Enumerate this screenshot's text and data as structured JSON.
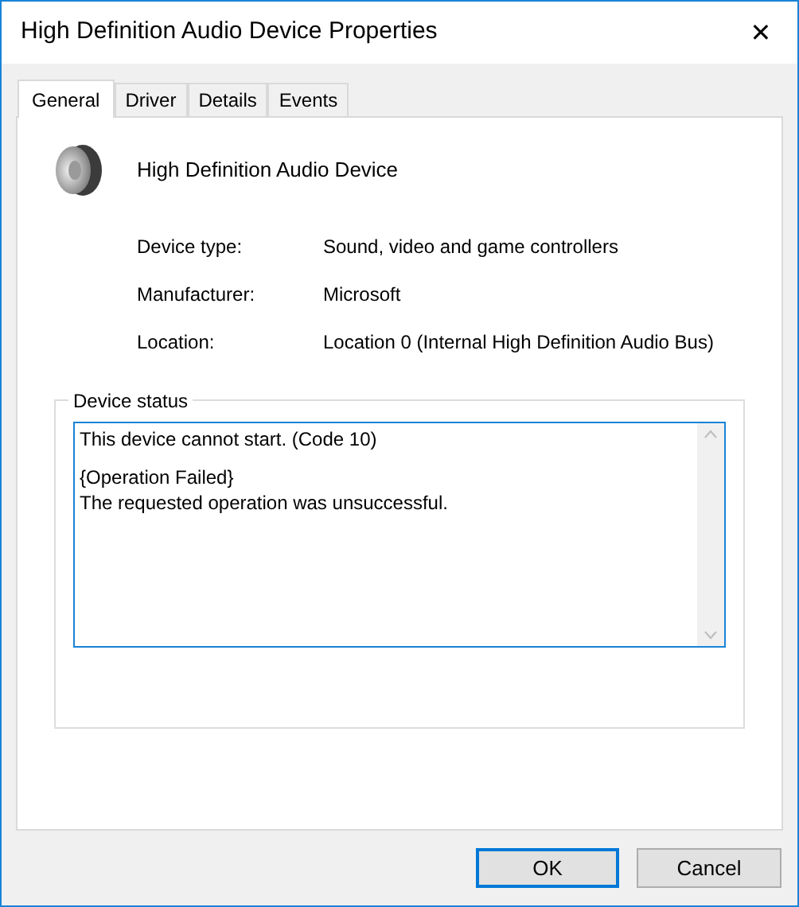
{
  "window": {
    "title": "High Definition Audio Device Properties",
    "close": "✕"
  },
  "tabs": [
    {
      "label": "General",
      "selected": true
    },
    {
      "label": "Driver",
      "selected": false
    },
    {
      "label": "Details",
      "selected": false
    },
    {
      "label": "Events",
      "selected": false
    }
  ],
  "device": {
    "name": "High Definition Audio Device"
  },
  "properties": [
    {
      "label": "Device type:",
      "value": "Sound, video and game controllers"
    },
    {
      "label": "Manufacturer:",
      "value": "Microsoft"
    },
    {
      "label": "Location:",
      "value": "Location 0 (Internal High Definition Audio Bus)"
    }
  ],
  "device_status": {
    "title": "Device status",
    "paragraphs": [
      [
        "This device cannot start. (Code 10)"
      ],
      [
        "{Operation Failed}",
        "The requested operation was unsuccessful."
      ]
    ]
  },
  "buttons": [
    {
      "label": "OK",
      "default": true
    },
    {
      "label": "Cancel",
      "default": false
    }
  ]
}
